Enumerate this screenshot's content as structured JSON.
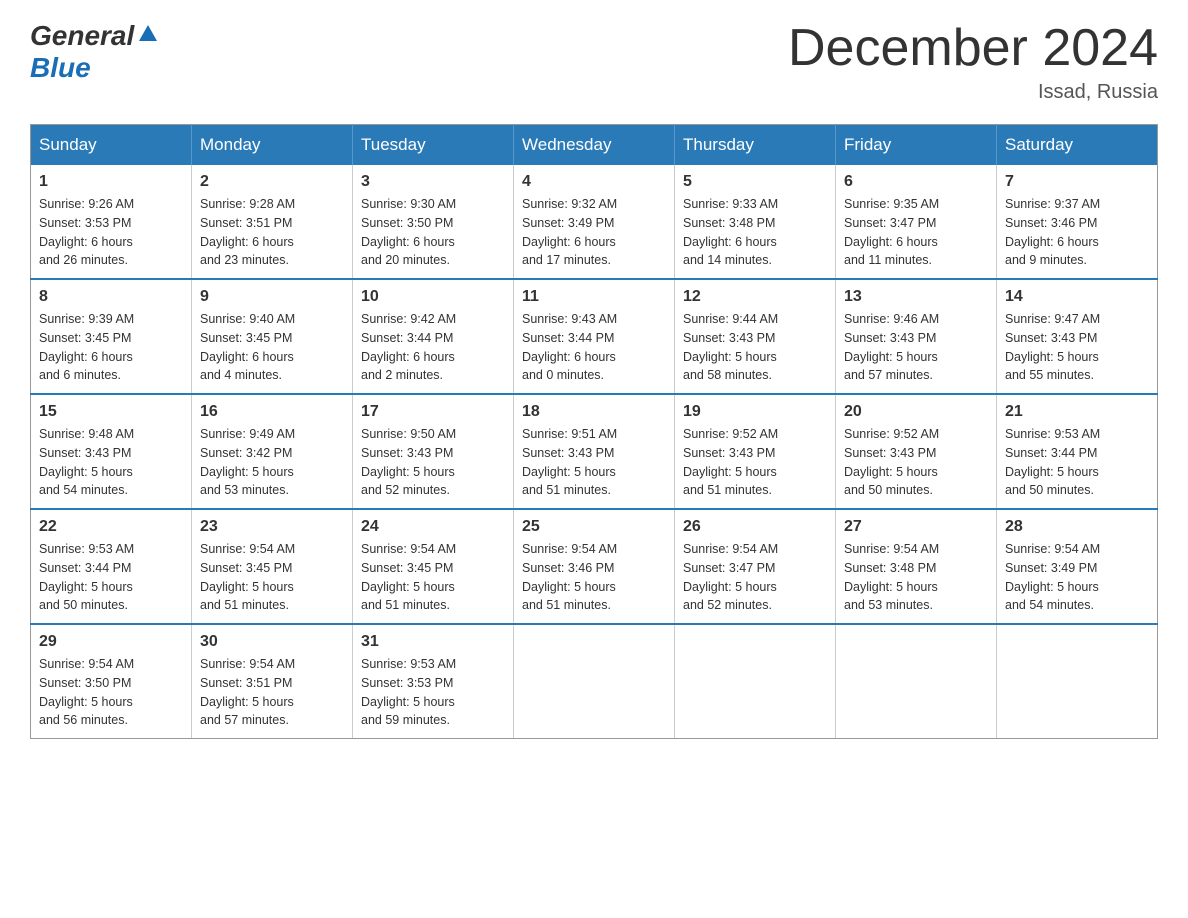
{
  "logo": {
    "general": "General",
    "blue": "Blue",
    "icon": "▲"
  },
  "title": "December 2024",
  "location": "Issad, Russia",
  "headers": [
    "Sunday",
    "Monday",
    "Tuesday",
    "Wednesday",
    "Thursday",
    "Friday",
    "Saturday"
  ],
  "weeks": [
    [
      {
        "day": "1",
        "info": "Sunrise: 9:26 AM\nSunset: 3:53 PM\nDaylight: 6 hours\nand 26 minutes."
      },
      {
        "day": "2",
        "info": "Sunrise: 9:28 AM\nSunset: 3:51 PM\nDaylight: 6 hours\nand 23 minutes."
      },
      {
        "day": "3",
        "info": "Sunrise: 9:30 AM\nSunset: 3:50 PM\nDaylight: 6 hours\nand 20 minutes."
      },
      {
        "day": "4",
        "info": "Sunrise: 9:32 AM\nSunset: 3:49 PM\nDaylight: 6 hours\nand 17 minutes."
      },
      {
        "day": "5",
        "info": "Sunrise: 9:33 AM\nSunset: 3:48 PM\nDaylight: 6 hours\nand 14 minutes."
      },
      {
        "day": "6",
        "info": "Sunrise: 9:35 AM\nSunset: 3:47 PM\nDaylight: 6 hours\nand 11 minutes."
      },
      {
        "day": "7",
        "info": "Sunrise: 9:37 AM\nSunset: 3:46 PM\nDaylight: 6 hours\nand 9 minutes."
      }
    ],
    [
      {
        "day": "8",
        "info": "Sunrise: 9:39 AM\nSunset: 3:45 PM\nDaylight: 6 hours\nand 6 minutes."
      },
      {
        "day": "9",
        "info": "Sunrise: 9:40 AM\nSunset: 3:45 PM\nDaylight: 6 hours\nand 4 minutes."
      },
      {
        "day": "10",
        "info": "Sunrise: 9:42 AM\nSunset: 3:44 PM\nDaylight: 6 hours\nand 2 minutes."
      },
      {
        "day": "11",
        "info": "Sunrise: 9:43 AM\nSunset: 3:44 PM\nDaylight: 6 hours\nand 0 minutes."
      },
      {
        "day": "12",
        "info": "Sunrise: 9:44 AM\nSunset: 3:43 PM\nDaylight: 5 hours\nand 58 minutes."
      },
      {
        "day": "13",
        "info": "Sunrise: 9:46 AM\nSunset: 3:43 PM\nDaylight: 5 hours\nand 57 minutes."
      },
      {
        "day": "14",
        "info": "Sunrise: 9:47 AM\nSunset: 3:43 PM\nDaylight: 5 hours\nand 55 minutes."
      }
    ],
    [
      {
        "day": "15",
        "info": "Sunrise: 9:48 AM\nSunset: 3:43 PM\nDaylight: 5 hours\nand 54 minutes."
      },
      {
        "day": "16",
        "info": "Sunrise: 9:49 AM\nSunset: 3:42 PM\nDaylight: 5 hours\nand 53 minutes."
      },
      {
        "day": "17",
        "info": "Sunrise: 9:50 AM\nSunset: 3:43 PM\nDaylight: 5 hours\nand 52 minutes."
      },
      {
        "day": "18",
        "info": "Sunrise: 9:51 AM\nSunset: 3:43 PM\nDaylight: 5 hours\nand 51 minutes."
      },
      {
        "day": "19",
        "info": "Sunrise: 9:52 AM\nSunset: 3:43 PM\nDaylight: 5 hours\nand 51 minutes."
      },
      {
        "day": "20",
        "info": "Sunrise: 9:52 AM\nSunset: 3:43 PM\nDaylight: 5 hours\nand 50 minutes."
      },
      {
        "day": "21",
        "info": "Sunrise: 9:53 AM\nSunset: 3:44 PM\nDaylight: 5 hours\nand 50 minutes."
      }
    ],
    [
      {
        "day": "22",
        "info": "Sunrise: 9:53 AM\nSunset: 3:44 PM\nDaylight: 5 hours\nand 50 minutes."
      },
      {
        "day": "23",
        "info": "Sunrise: 9:54 AM\nSunset: 3:45 PM\nDaylight: 5 hours\nand 51 minutes."
      },
      {
        "day": "24",
        "info": "Sunrise: 9:54 AM\nSunset: 3:45 PM\nDaylight: 5 hours\nand 51 minutes."
      },
      {
        "day": "25",
        "info": "Sunrise: 9:54 AM\nSunset: 3:46 PM\nDaylight: 5 hours\nand 51 minutes."
      },
      {
        "day": "26",
        "info": "Sunrise: 9:54 AM\nSunset: 3:47 PM\nDaylight: 5 hours\nand 52 minutes."
      },
      {
        "day": "27",
        "info": "Sunrise: 9:54 AM\nSunset: 3:48 PM\nDaylight: 5 hours\nand 53 minutes."
      },
      {
        "day": "28",
        "info": "Sunrise: 9:54 AM\nSunset: 3:49 PM\nDaylight: 5 hours\nand 54 minutes."
      }
    ],
    [
      {
        "day": "29",
        "info": "Sunrise: 9:54 AM\nSunset: 3:50 PM\nDaylight: 5 hours\nand 56 minutes."
      },
      {
        "day": "30",
        "info": "Sunrise: 9:54 AM\nSunset: 3:51 PM\nDaylight: 5 hours\nand 57 minutes."
      },
      {
        "day": "31",
        "info": "Sunrise: 9:53 AM\nSunset: 3:53 PM\nDaylight: 5 hours\nand 59 minutes."
      },
      {
        "day": "",
        "info": ""
      },
      {
        "day": "",
        "info": ""
      },
      {
        "day": "",
        "info": ""
      },
      {
        "day": "",
        "info": ""
      }
    ]
  ]
}
